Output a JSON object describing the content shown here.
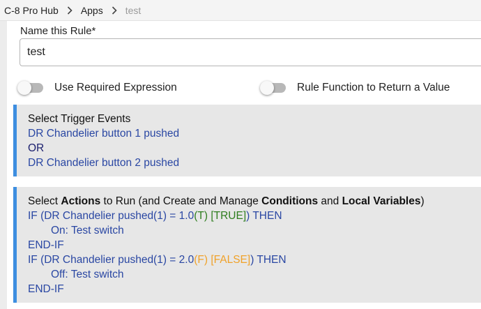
{
  "breadcrumb": {
    "hub": "C-8 Pro Hub",
    "apps": "Apps",
    "current": "test"
  },
  "rule_name": {
    "label": "Name this Rule*",
    "value": "test"
  },
  "toggles": {
    "required_expression": {
      "label": "Use Required Expression",
      "on": false
    },
    "rule_function": {
      "label": "Rule Function to Return a Value",
      "on": false
    }
  },
  "triggers": {
    "title": "Select Trigger Events",
    "event1": "DR Chandelier button 1 pushed",
    "or_label": "OR",
    "event2": "DR Chandelier button 2 pushed"
  },
  "actions": {
    "title_prefix": "Select ",
    "title_actions": "Actions",
    "title_mid1": " to Run (and Create and Manage ",
    "title_conditions": "Conditions",
    "title_mid2": " and ",
    "title_locals": "Local Variables",
    "title_suffix": ")",
    "if1_prefix": "IF (DR Chandelier pushed(1) = 1.0",
    "if1_t": "(T)",
    "if1_state": "[TRUE]",
    "if1_suffix": ") THEN",
    "if1_action": "On: Test switch",
    "endif1": "END-IF",
    "if2_prefix": "IF (DR Chandelier pushed(1) = 2.0",
    "if2_f": "(F)",
    "if2_state": "[FALSE]",
    "if2_suffix": ") THEN",
    "if2_action": "Off: Test switch",
    "endif2": "END-IF"
  },
  "colors": {
    "card_accent": "#3d8ee0",
    "link_blue": "#2a47a3",
    "true_green": "#2e7d1e",
    "false_orange": "#f0a22a"
  }
}
